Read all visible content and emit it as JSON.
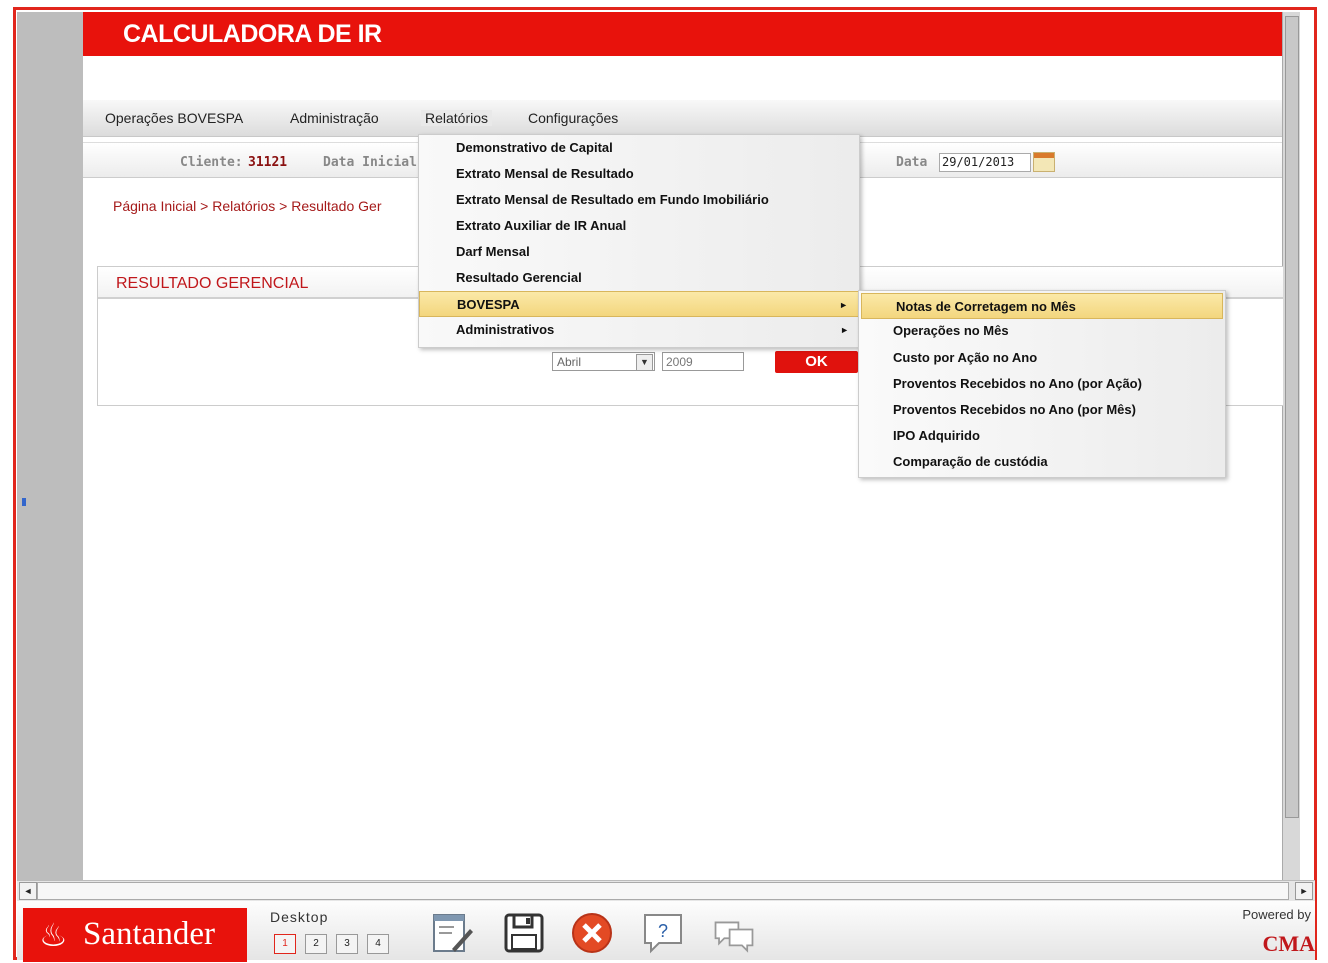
{
  "app": {
    "title": "CALCULADORA DE IR"
  },
  "menu": {
    "items": [
      "Operações BOVESPA",
      "Administração",
      "Relatórios",
      "Configurações"
    ],
    "active": "Relatórios"
  },
  "filter": {
    "client_label": "Cliente:",
    "client_value": "31121",
    "start_label": "Data Inicial",
    "date_label": "Data",
    "date_value": "29/01/2013"
  },
  "breadcrumb": "Página Inicial > Relatórios > Resultado Ger",
  "panel": {
    "title": "RESULTADO GERENCIAL",
    "month_value": "Abril",
    "year_value": "2009",
    "ok_label": "OK"
  },
  "dropdown": {
    "items": [
      "Demonstrativo de Capital",
      "Extrato Mensal de Resultado",
      "Extrato Mensal de Resultado em Fundo Imobiliário",
      "Extrato Auxiliar de IR Anual",
      "Darf Mensal",
      "Resultado Gerencial",
      "BOVESPA",
      "Administrativos"
    ],
    "highlighted": "BOVESPA"
  },
  "submenu": {
    "items": [
      "Notas de Corretagem no Mês",
      "Operações no Mês",
      "Custo por Ação no Ano",
      "Proventos Recebidos no Ano (por Ação)",
      "Proventos Recebidos no Ano (por Mês)",
      "IPO Adquirido",
      "Comparação de custódia"
    ],
    "highlighted": "Notas de Corretagem no Mês"
  },
  "footer": {
    "brand": "Santander",
    "desktop_label": "Desktop",
    "desktops": [
      "1",
      "2",
      "3",
      "4"
    ],
    "powered_by": "Powered by",
    "vendor": "CMA"
  },
  "colors": {
    "brand_red": "#e8120c",
    "highlight": "#f3d67e",
    "breadcrumb": "#a51a1a"
  }
}
